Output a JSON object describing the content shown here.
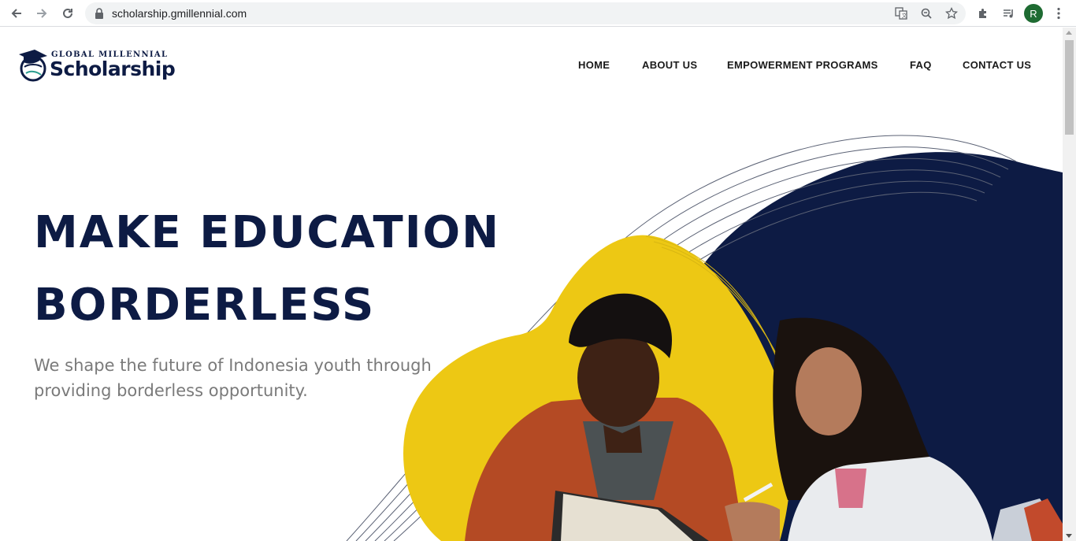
{
  "browser": {
    "url_host": "scholarship.gmillennial.com",
    "profile_initial": "R",
    "profile_color": "#1e6b32"
  },
  "site": {
    "logo": {
      "line1": "GLOBAL MILLENNIAL",
      "line2": "Scholarship"
    },
    "nav": {
      "home": "HOME",
      "about": "ABOUT US",
      "programs": "EMPOWERMENT PROGRAMS",
      "faq": "FAQ",
      "contact": "CONTACT US"
    },
    "hero": {
      "title_line1": "MAKE EDUCATION",
      "title_line2": "BORDERLESS",
      "subtitle": "We shape the future of Indonesia youth through providing borderless opportunity."
    },
    "colors": {
      "navy": "#0d1b44",
      "yellow": "#edc814",
      "subtitle_gray": "#7a7a7a"
    }
  }
}
